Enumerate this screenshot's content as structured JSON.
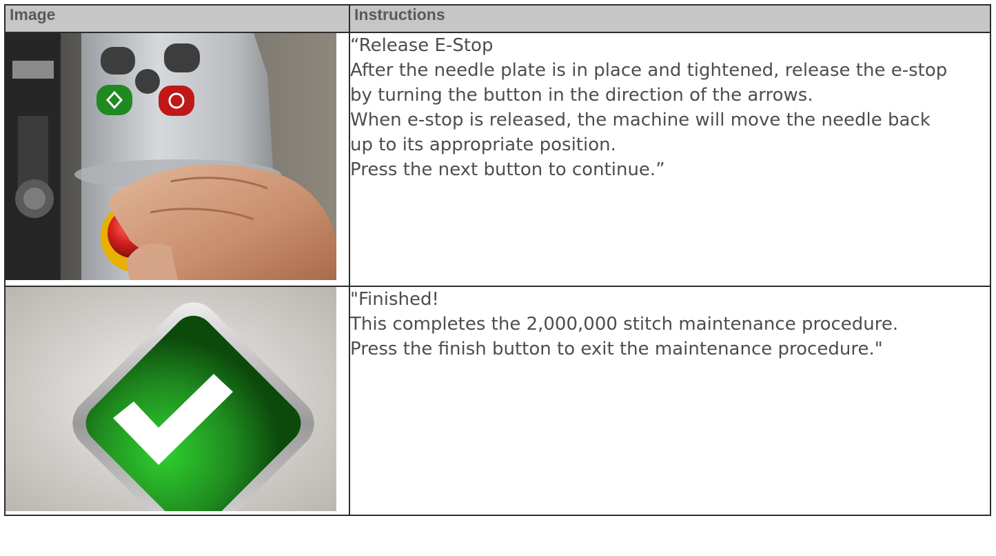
{
  "table": {
    "headers": {
      "image": "Image",
      "instructions": "Instructions"
    },
    "rows": [
      {
        "image": {
          "description": "estop-release-photo",
          "icon": "emergency-stop-button"
        },
        "lines": [
          "“Release E-Stop",
          "After the needle plate is in place and tightened, release the e-stop",
          "by turning the button in the direction of the arrows.",
          "When e-stop is released, the machine will move the needle back",
          "up to its appropriate position.",
          "Press the next button to continue.”"
        ]
      },
      {
        "image": {
          "description": "finished-checkmark",
          "icon": "checkmark-icon"
        },
        "lines": [
          "\"Finished!",
          "This completes the 2,000,000 stitch maintenance procedure.",
          "Press the finish button to exit the maintenance procedure.\""
        ]
      }
    ]
  },
  "colors": {
    "header_bg": "#c6c6c6",
    "header_text": "#5a5a5a",
    "body_text": "#4d4d4d",
    "estop_red": "#d42020",
    "estop_yellow": "#e8b000",
    "check_green": "#1f8a1f"
  }
}
